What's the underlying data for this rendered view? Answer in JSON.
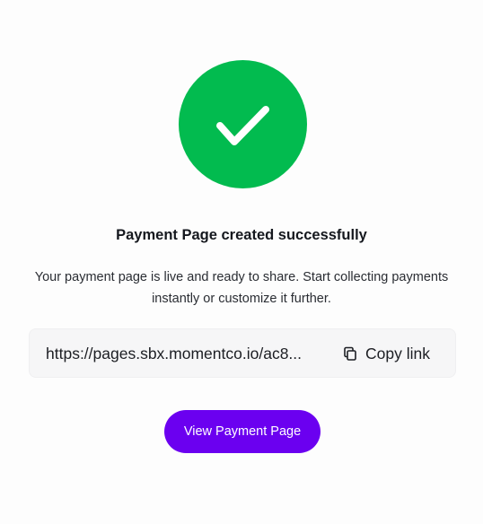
{
  "success": {
    "icon": "checkmark-icon",
    "color": "#02bb4f",
    "title": "Payment Page created successfully",
    "description": "Your payment page is live and ready to share. Start collecting payments instantly or customize it further."
  },
  "link": {
    "url_display": "https://pages.sbx.momentco.io/ac8...",
    "copy_label": "Copy link",
    "copy_icon": "copy-icon"
  },
  "actions": {
    "view_label": "View Payment Page",
    "view_color": "#6b00f0"
  }
}
